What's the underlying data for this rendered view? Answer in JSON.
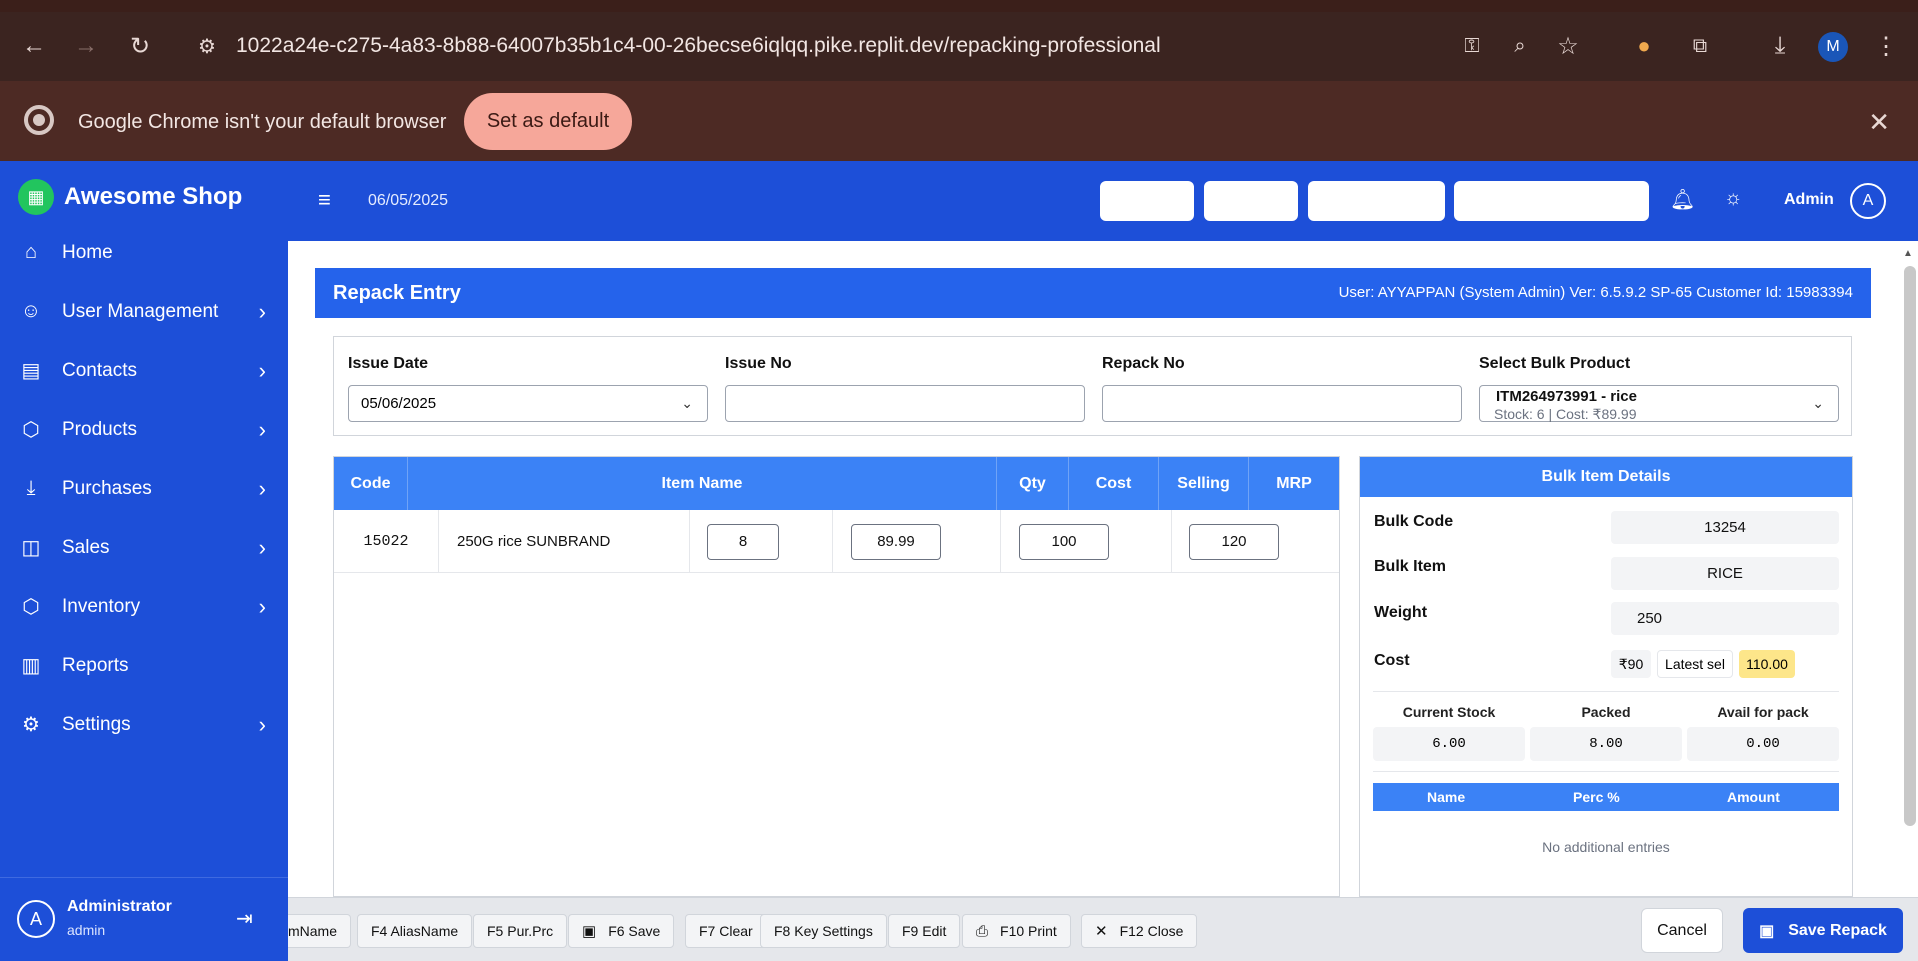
{
  "browser": {
    "url": "1022a24e-c275-4a83-8b88-64007b35b1c4-00-26becse6iqlqq.pike.replit.dev/repacking-professional",
    "profile_initial": "M",
    "infobar_message": "Google Chrome isn't your default browser",
    "infobar_button": "Set as default"
  },
  "sidebar": {
    "brand": "Awesome Shop",
    "items": [
      {
        "label": "Home",
        "icon": "home-icon",
        "has_children": false
      },
      {
        "label": "User Management",
        "icon": "user-icon",
        "has_children": true
      },
      {
        "label": "Contacts",
        "icon": "contacts-icon",
        "has_children": true
      },
      {
        "label": "Products",
        "icon": "box-icon",
        "has_children": true
      },
      {
        "label": "Purchases",
        "icon": "download-icon",
        "has_children": true
      },
      {
        "label": "Sales",
        "icon": "bag-icon",
        "has_children": true
      },
      {
        "label": "Inventory",
        "icon": "box-icon",
        "has_children": true
      },
      {
        "label": "Reports",
        "icon": "chart-icon",
        "has_children": false
      },
      {
        "label": "Settings",
        "icon": "gear-icon",
        "has_children": true
      }
    ],
    "footer": {
      "avatar": "A",
      "name": "Administrator",
      "role": "admin"
    }
  },
  "header": {
    "date": "06/05/2025",
    "user_label": "Admin",
    "avatar": "A"
  },
  "page": {
    "title": "Repack Entry",
    "meta": "User: AYYAPPAN (System Admin)  Ver: 6.5.9.2 SP-65  Customer Id: 15983394"
  },
  "form": {
    "issue_date_label": "Issue Date",
    "issue_date_value": "05/06/2025",
    "issue_no_label": "Issue No",
    "issue_no_value": "",
    "repack_no_label": "Repack No",
    "repack_no_value": "",
    "bulk_product_label": "Select Bulk Product",
    "bulk_product_line1": "ITM264973991 - rice",
    "bulk_product_line2": "Stock: 6 | Cost: ₹89.99"
  },
  "items_table": {
    "headers": [
      "Code",
      "Item Name",
      "Qty",
      "Cost",
      "Selling",
      "MRP"
    ],
    "rows": [
      {
        "code": "15022",
        "name": "250G rice SUNBRAND",
        "qty": "8",
        "cost": "89.99",
        "selling": "100",
        "mrp": "120"
      }
    ]
  },
  "bulk_details": {
    "title": "Bulk Item Details",
    "bulk_code_label": "Bulk Code",
    "bulk_code": "13254",
    "bulk_item_label": "Bulk Item",
    "bulk_item": "RICE",
    "weight_label": "Weight",
    "weight": "250",
    "cost_label": "Cost",
    "cost_value": "₹90",
    "latest_sel_label": "Latest sel",
    "latest_sel_value": "110.00",
    "current_stock_label": "Current Stock",
    "current_stock": "6.00",
    "packed_label": "Packed",
    "packed": "8.00",
    "avail_label": "Avail for pack",
    "avail": "0.00",
    "sub_headers": [
      "Name",
      "Perc %",
      "Amount"
    ],
    "empty_note": "No additional entries"
  },
  "bottom_bar": {
    "keys": [
      {
        "label": "mName",
        "icon": ""
      },
      {
        "label": "F4 AliasName",
        "icon": ""
      },
      {
        "label": "F5 Pur.Prc",
        "icon": ""
      },
      {
        "label": "F6 Save",
        "icon": "save-icon"
      },
      {
        "label": "F7 Clear",
        "icon": ""
      },
      {
        "label": "F8 Key Settings",
        "icon": ""
      },
      {
        "label": "F9 Edit",
        "icon": ""
      },
      {
        "label": "F10 Print",
        "icon": "printer-icon"
      },
      {
        "label": "F12 Close",
        "icon": "close-icon"
      }
    ],
    "cancel_label": "Cancel",
    "save_label": "Save Repack"
  },
  "colors": {
    "brand_blue": "#1d4fd8",
    "header_blue": "#2563eb",
    "table_blue": "#3b82f6",
    "highlight_yellow": "#fde68a"
  }
}
